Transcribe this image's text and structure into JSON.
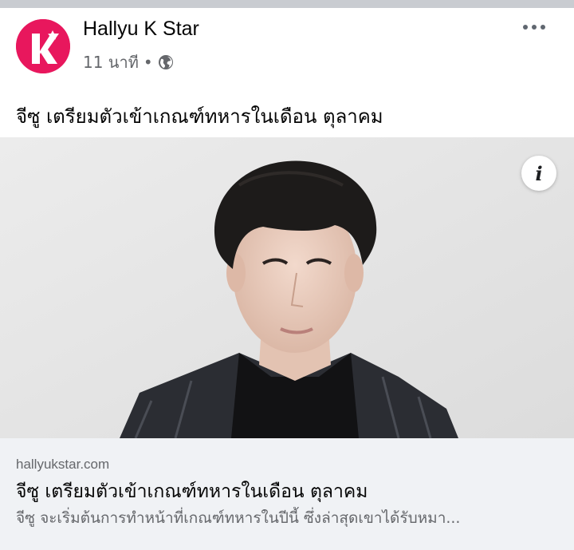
{
  "post": {
    "page_name": "Hallyu K Star",
    "time": "11 นาที",
    "separator": "•",
    "text": "จีซู เตรียมตัวเข้าเกณฑ์ทหารในเดือน ตุลาคม"
  },
  "link_preview": {
    "domain": "hallyukstar.com",
    "title": "จีซู เตรียมตัวเข้าเกณฑ์ทหารในเดือน ตุลาคม",
    "description": "จีซู จะเริ่มต้นการทำหน้าที่เกณฑ์ทหารในปีนี้ ซึ่งล่าสุดเขาได้รับหมา..."
  },
  "info_button": {
    "label": "i"
  },
  "icons": {
    "avatar": "hallyu-k-star-logo",
    "privacy": "globe-icon",
    "menu": "more-options-icon",
    "info": "info-icon"
  },
  "colors": {
    "brand": "#e8175d",
    "secondary_text": "#65676b",
    "link_box": "#f0f2f5"
  }
}
